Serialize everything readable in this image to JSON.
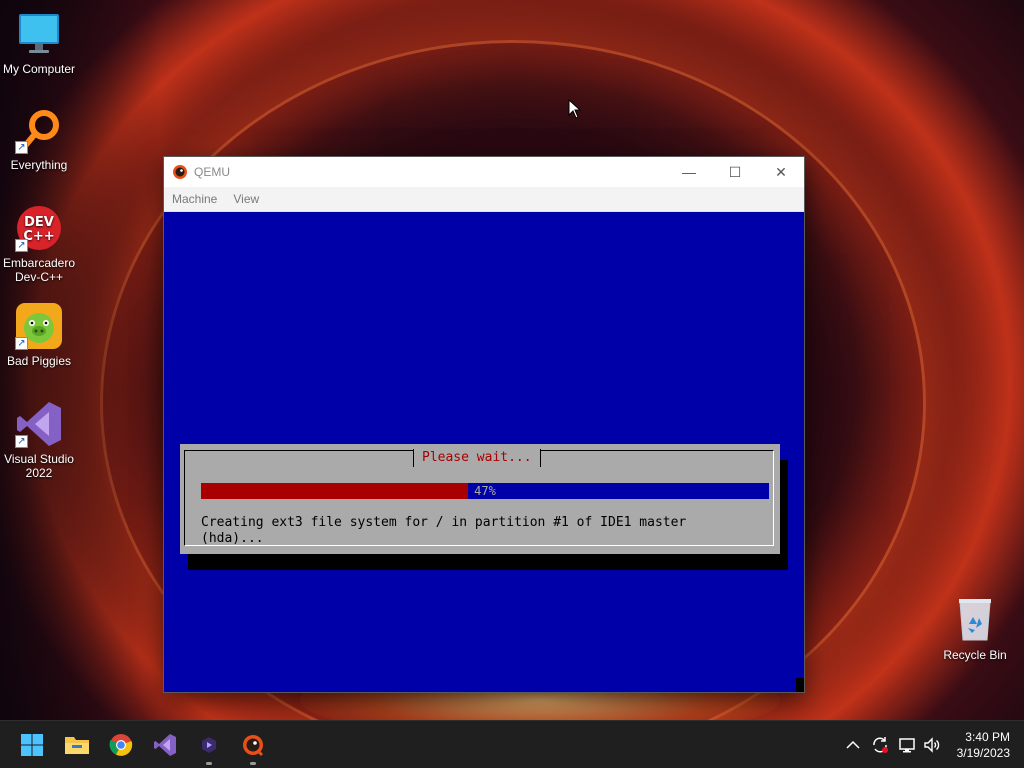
{
  "desktop": {
    "icons": [
      {
        "label": "My Computer",
        "icon": "monitor-icon"
      },
      {
        "label": "Everything",
        "icon": "everything-search-icon"
      },
      {
        "label": "Embarcadero Dev-C++",
        "icon": "devcpp-icon",
        "badge": "DEV C++"
      },
      {
        "label": "Bad Piggies",
        "icon": "bad-piggies-icon"
      },
      {
        "label": "Visual Studio 2022",
        "icon": "visual-studio-icon"
      }
    ],
    "recycle_bin": {
      "label": "Recycle Bin",
      "icon": "recycle-bin-icon"
    }
  },
  "window": {
    "title": "QEMU",
    "menu": [
      "Machine",
      "View"
    ],
    "controls": {
      "minimize": "—",
      "maximize": "☐",
      "close": "✕"
    }
  },
  "installer": {
    "dialog_title": "Please wait...",
    "progress_percent": 47,
    "progress_label": "47%",
    "message_line1": "Creating ext3 file system for / in partition #1 of IDE1 master",
    "message_line2": "(hda)...",
    "colors": {
      "screen": "#0000a8",
      "dialog": "#aaaaaa",
      "bar": "#a80000",
      "title": "#a80000"
    }
  },
  "taskbar": {
    "apps": [
      {
        "name": "Start",
        "icon": "windows-start-icon"
      },
      {
        "name": "File Explorer",
        "icon": "file-explorer-icon"
      },
      {
        "name": "Google Chrome",
        "icon": "chrome-icon"
      },
      {
        "name": "Visual Studio 2022",
        "icon": "visual-studio-icon"
      },
      {
        "name": "Visual Studio Installer",
        "icon": "vs-installer-icon"
      },
      {
        "name": "QEMU",
        "icon": "qemu-icon"
      }
    ],
    "tray_icons": [
      "chevron-up-icon",
      "sync-icon",
      "network-icon",
      "volume-icon"
    ],
    "time": "3:40 PM",
    "date": "3/19/2023"
  }
}
